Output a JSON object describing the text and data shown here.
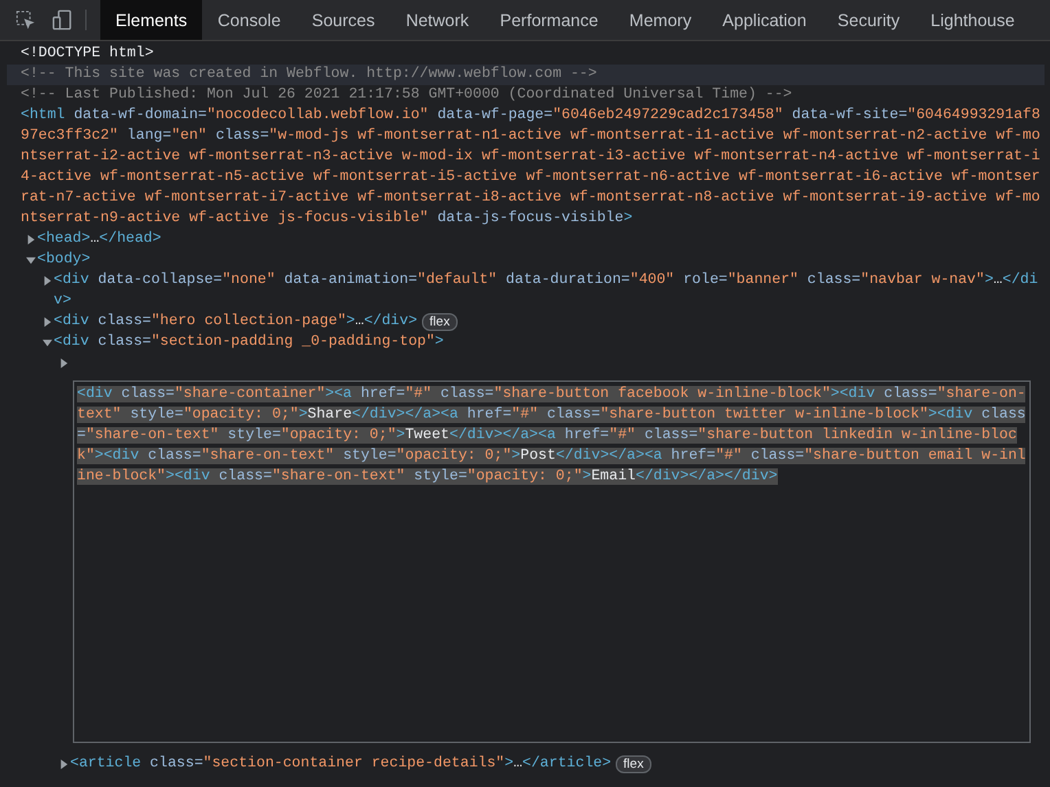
{
  "toolbar": {
    "tools": [
      {
        "kind": "inspect"
      },
      {
        "kind": "device"
      }
    ],
    "tabs": [
      {
        "label": "Elements",
        "selected": true
      },
      {
        "label": "Console",
        "selected": false
      },
      {
        "label": "Sources",
        "selected": false
      },
      {
        "label": "Network",
        "selected": false
      },
      {
        "label": "Performance",
        "selected": false
      },
      {
        "label": "Memory",
        "selected": false
      },
      {
        "label": "Application",
        "selected": false
      },
      {
        "label": "Security",
        "selected": false
      },
      {
        "label": "Lighthouse",
        "selected": false
      }
    ]
  },
  "tree": [
    {
      "kind": "doctype",
      "hovered": false,
      "tokens": [
        {
          "kind": "text",
          "text": "<!DOCTYPE html>"
        }
      ]
    },
    {
      "kind": "comment",
      "hovered": true,
      "tokens": [
        {
          "kind": "comment",
          "text": "<!-- This site was created in Webflow. http://www.webflow.com -->"
        }
      ]
    },
    {
      "kind": "comment",
      "hovered": false,
      "tokens": [
        {
          "kind": "comment",
          "text": "<!-- Last Published: Mon Jul 26 2021 21:17:58 GMT+0000 (Coordinated Universal Time) -->"
        }
      ]
    },
    {
      "kind": "root",
      "hovered": false,
      "tokens": [
        {
          "kind": "tag",
          "text": "<html"
        },
        {
          "kind": "attr",
          "text": " data-wf-domain="
        },
        {
          "kind": "value",
          "text": "\"nocodecollab.webflow.io\""
        },
        {
          "kind": "attr",
          "text": " data-wf-page="
        },
        {
          "kind": "value",
          "text": "\"6046eb2497229cad2c173458\""
        },
        {
          "kind": "attr",
          "text": " data-wf-site="
        },
        {
          "kind": "value",
          "text": "\"60464993291af897ec3ff3c2\""
        },
        {
          "kind": "attr",
          "text": " lang="
        },
        {
          "kind": "value",
          "text": "\"en\""
        },
        {
          "kind": "attr",
          "text": " class="
        },
        {
          "kind": "value",
          "text": "\"w-mod-js wf-montserrat-n1-active wf-montserrat-i1-active wf-montserrat-n2-active wf-montserrat-i2-active wf-montserrat-n3-active w-mod-ix wf-montserrat-i3-active wf-montserrat-n4-active wf-montserrat-i4-active wf-montserrat-n5-active wf-montserrat-i5-active wf-montserrat-n6-active wf-montserrat-i6-active wf-montserrat-n7-active wf-montserrat-i7-active wf-montserrat-i8-active wf-montserrat-n8-active wf-montserrat-i9-active wf-montserrat-n9-active wf-active js-focus-visible\""
        },
        {
          "kind": "attr",
          "text": " data-js-focus-visible"
        },
        {
          "kind": "tag",
          "text": ">"
        }
      ],
      "children": [
        {
          "kind": "element",
          "expanded": false,
          "hovered": false,
          "tokens": [
            {
              "kind": "tag",
              "text": "<head>"
            },
            {
              "kind": "text",
              "text": "…"
            },
            {
              "kind": "tag",
              "text": "</head>"
            }
          ]
        },
        {
          "kind": "element",
          "expanded": true,
          "hovered": false,
          "tokens": [
            {
              "kind": "tag",
              "text": "<body>"
            }
          ],
          "children": [
            {
              "kind": "element",
              "expanded": false,
              "hovered": false,
              "tokens": [
                {
                  "kind": "tag",
                  "text": "<div"
                },
                {
                  "kind": "attr",
                  "text": " data-collapse="
                },
                {
                  "kind": "value",
                  "text": "\"none\""
                },
                {
                  "kind": "attr",
                  "text": " data-animation="
                },
                {
                  "kind": "value",
                  "text": "\"default\""
                },
                {
                  "kind": "attr",
                  "text": " data-duration="
                },
                {
                  "kind": "value",
                  "text": "\"400\""
                },
                {
                  "kind": "attr",
                  "text": " role="
                },
                {
                  "kind": "value",
                  "text": "\"banner\""
                },
                {
                  "kind": "attr",
                  "text": " class="
                },
                {
                  "kind": "value",
                  "text": "\"navbar w-nav\""
                },
                {
                  "kind": "tag",
                  "text": ">"
                },
                {
                  "kind": "text",
                  "text": "…"
                },
                {
                  "kind": "tag",
                  "text": "</div>"
                }
              ]
            },
            {
              "kind": "element",
              "expanded": false,
              "hovered": false,
              "badge": "flex",
              "tokens": [
                {
                  "kind": "tag",
                  "text": "<div"
                },
                {
                  "kind": "attr",
                  "text": " class="
                },
                {
                  "kind": "value",
                  "text": "\"hero collection-page\""
                },
                {
                  "kind": "tag",
                  "text": ">"
                },
                {
                  "kind": "text",
                  "text": "…"
                },
                {
                  "kind": "tag",
                  "text": "</div>"
                }
              ]
            },
            {
              "kind": "element",
              "expanded": true,
              "hovered": false,
              "tokens": [
                {
                  "kind": "tag",
                  "text": "<div"
                },
                {
                  "kind": "attr",
                  "text": " class="
                },
                {
                  "kind": "value",
                  "text": "\"section-padding _0-padding-top\""
                },
                {
                  "kind": "tag",
                  "text": ">"
                }
              ],
              "children": [
                {
                  "kind": "editor",
                  "expanded": false,
                  "hovered": false,
                  "selected": true,
                  "tokens": [
                    {
                      "kind": "tag",
                      "text": "<div"
                    },
                    {
                      "kind": "attr",
                      "text": " class="
                    },
                    {
                      "kind": "value",
                      "text": "\"share-container\""
                    },
                    {
                      "kind": "tag",
                      "text": "><a"
                    },
                    {
                      "kind": "attr",
                      "text": " href="
                    },
                    {
                      "kind": "value",
                      "text": "\"#\""
                    },
                    {
                      "kind": "attr",
                      "text": " class="
                    },
                    {
                      "kind": "value",
                      "text": "\"share-button facebook w-inline-block\""
                    },
                    {
                      "kind": "tag",
                      "text": "><div"
                    },
                    {
                      "kind": "attr",
                      "text": " class="
                    },
                    {
                      "kind": "value",
                      "text": "\"share-on-text\""
                    },
                    {
                      "kind": "attr",
                      "text": " style="
                    },
                    {
                      "kind": "value",
                      "text": "\"opacity: 0;\""
                    },
                    {
                      "kind": "tag",
                      "text": ">"
                    },
                    {
                      "kind": "text",
                      "text": "Share"
                    },
                    {
                      "kind": "tag",
                      "text": "</div></a><a"
                    },
                    {
                      "kind": "attr",
                      "text": " href="
                    },
                    {
                      "kind": "value",
                      "text": "\"#\""
                    },
                    {
                      "kind": "attr",
                      "text": " class="
                    },
                    {
                      "kind": "value",
                      "text": "\"share-button twitter w-inline-block\""
                    },
                    {
                      "kind": "tag",
                      "text": "><div"
                    },
                    {
                      "kind": "attr",
                      "text": " class="
                    },
                    {
                      "kind": "value",
                      "text": "\"share-on-text\""
                    },
                    {
                      "kind": "attr",
                      "text": " style="
                    },
                    {
                      "kind": "value",
                      "text": "\"opacity: 0;\""
                    },
                    {
                      "kind": "tag",
                      "text": ">"
                    },
                    {
                      "kind": "text",
                      "text": "Tweet"
                    },
                    {
                      "kind": "tag",
                      "text": "</div></a><a"
                    },
                    {
                      "kind": "attr",
                      "text": " href="
                    },
                    {
                      "kind": "value",
                      "text": "\"#\""
                    },
                    {
                      "kind": "attr",
                      "text": " class="
                    },
                    {
                      "kind": "value",
                      "text": "\"share-button linkedin w-inline-block\""
                    },
                    {
                      "kind": "tag",
                      "text": "><div"
                    },
                    {
                      "kind": "attr",
                      "text": " class="
                    },
                    {
                      "kind": "value",
                      "text": "\"share-on-text\""
                    },
                    {
                      "kind": "attr",
                      "text": " style="
                    },
                    {
                      "kind": "value",
                      "text": "\"opacity: 0;\""
                    },
                    {
                      "kind": "tag",
                      "text": ">"
                    },
                    {
                      "kind": "text",
                      "text": "Post"
                    },
                    {
                      "kind": "tag",
                      "text": "</div></a><a"
                    },
                    {
                      "kind": "attr",
                      "text": " href="
                    },
                    {
                      "kind": "value",
                      "text": "\"#\""
                    },
                    {
                      "kind": "attr",
                      "text": " class="
                    },
                    {
                      "kind": "value",
                      "text": "\"share-button email w-inline-block\""
                    },
                    {
                      "kind": "tag",
                      "text": "><div"
                    },
                    {
                      "kind": "attr",
                      "text": " class="
                    },
                    {
                      "kind": "value",
                      "text": "\"share-on-text\""
                    },
                    {
                      "kind": "attr",
                      "text": " style="
                    },
                    {
                      "kind": "value",
                      "text": "\"opacity: 0;\""
                    },
                    {
                      "kind": "tag",
                      "text": ">"
                    },
                    {
                      "kind": "text",
                      "text": "Email"
                    },
                    {
                      "kind": "tag",
                      "text": "</div></a></div>"
                    }
                  ]
                },
                {
                  "kind": "element",
                  "expanded": false,
                  "hovered": false,
                  "badge": "flex",
                  "tokens": [
                    {
                      "kind": "tag",
                      "text": "<article"
                    },
                    {
                      "kind": "attr",
                      "text": " class="
                    },
                    {
                      "kind": "value",
                      "text": "\"section-container recipe-details\""
                    },
                    {
                      "kind": "tag",
                      "text": ">"
                    },
                    {
                      "kind": "text",
                      "text": "…"
                    },
                    {
                      "kind": "tag",
                      "text": "</article>"
                    }
                  ]
                }
              ]
            }
          ]
        }
      ]
    }
  ]
}
